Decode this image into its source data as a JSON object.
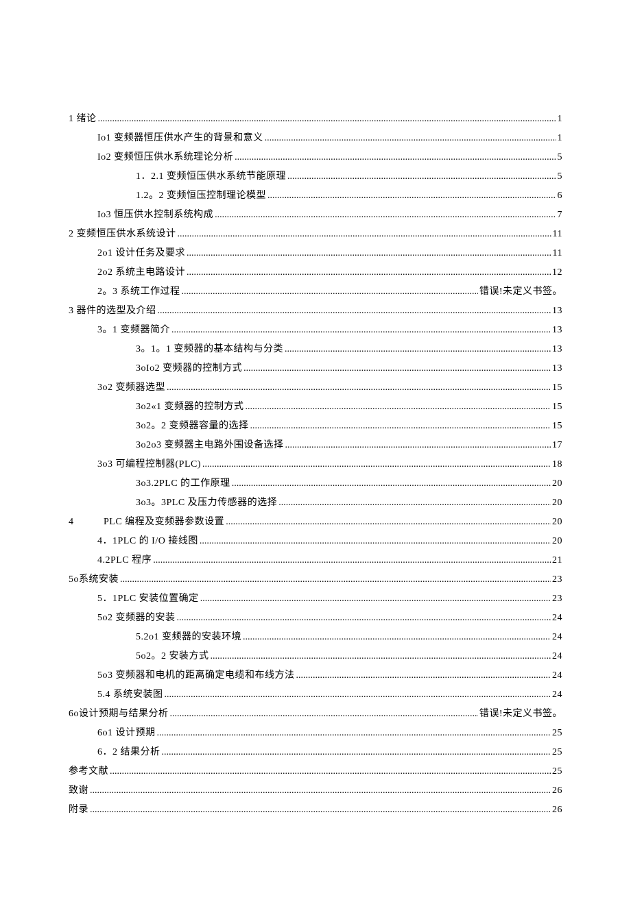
{
  "toc": [
    {
      "indent": 0,
      "label": "1 绪论",
      "page": "1"
    },
    {
      "indent": 1,
      "label": "Io1 变频器恒压供水产生的背景和意义",
      "page": "1"
    },
    {
      "indent": 1,
      "label": "Io2 变频恒压供水系统理论分析",
      "page": "5"
    },
    {
      "indent": 2,
      "label": "1．2.1 变频恒压供水系统节能原理",
      "page": "5"
    },
    {
      "indent": 2,
      "label": "1.2。2 变频恒压控制理论模型",
      "page": "6"
    },
    {
      "indent": 1,
      "label": "Io3 恒压供水控制系统构成",
      "page": "7"
    },
    {
      "indent": 0,
      "label": "2 变频恒压供水系统设计",
      "page": "11"
    },
    {
      "indent": 1,
      "label": "2o1 设计任务及要求",
      "page": "11"
    },
    {
      "indent": 1,
      "label": "2o2 系统主电路设计",
      "page": "12"
    },
    {
      "indent": 1,
      "label": "2。3 系统工作过程",
      "page": "错误!未定义书签。"
    },
    {
      "indent": 0,
      "label": "3 器件的选型及介绍",
      "page": "13"
    },
    {
      "indent": 1,
      "label": "3。1 变频器简介",
      "page": "13"
    },
    {
      "indent": 2,
      "label": "3。1。1 变频器的基本结构与分类",
      "page": "13"
    },
    {
      "indent": 2,
      "label": "3oIo2 变频器的控制方式",
      "page": "13"
    },
    {
      "indent": 1,
      "label": "3o2 变频器选型",
      "page": "15"
    },
    {
      "indent": 2,
      "label": "3o2«1 变频器的控制方式",
      "page": "15"
    },
    {
      "indent": 2,
      "label": "3o2。2 变频器容量的选择",
      "page": "15"
    },
    {
      "indent": 2,
      "label": "3o2o3 变频器主电路外围设备选择",
      "page": "17"
    },
    {
      "indent": 1,
      "label": "3o3 可编程控制器(PLC)",
      "page": "18"
    },
    {
      "indent": 2,
      "label": "3o3.2PLC 的工作原理",
      "page": "20"
    },
    {
      "indent": 2,
      "label": "3o3。3PLC 及压力传感器的选择",
      "page": "20"
    },
    {
      "indent": 0,
      "label": "4　　　PLC 编程及变频器参数设置",
      "page": "20"
    },
    {
      "indent": 1,
      "label": "4．1PLC 的 I/O 接线图",
      "page": "20"
    },
    {
      "indent": 1,
      "label": "4.2PLC 程序",
      "page": "21"
    },
    {
      "indent": 0,
      "label": "5o系统安装",
      "page": "23"
    },
    {
      "indent": 1,
      "label": "5．1PLC 安装位置确定",
      "page": "23"
    },
    {
      "indent": 1,
      "label": "5o2 变频器的安装",
      "page": "24"
    },
    {
      "indent": 2,
      "label": "5.2o1 变频器的安装环境",
      "page": "24"
    },
    {
      "indent": 2,
      "label": "5o2。2 安装方式",
      "page": "24"
    },
    {
      "indent": 1,
      "label": "5o3 变频器和电机的距离确定电缆和布线方法",
      "page": "24"
    },
    {
      "indent": 1,
      "label": "5.4 系统安装图",
      "page": "24"
    },
    {
      "indent": 0,
      "label": "6o设计预期与结果分析",
      "page": "错误!未定义书签。"
    },
    {
      "indent": 1,
      "label": "6o1 设计预期",
      "page": "25"
    },
    {
      "indent": 1,
      "label": "6．2 结果分析",
      "page": "25"
    },
    {
      "indent": 0,
      "label": "参考文献",
      "page": "25"
    },
    {
      "indent": 0,
      "label": "致谢",
      "page": "26"
    },
    {
      "indent": 0,
      "label": "附录",
      "page": "26"
    }
  ]
}
